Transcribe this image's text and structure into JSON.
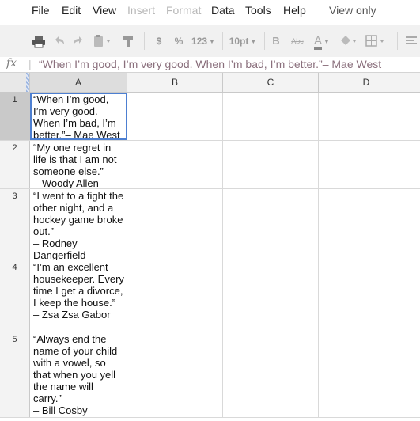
{
  "menu": [
    {
      "label": "File",
      "disabled": false
    },
    {
      "label": "Edit",
      "disabled": false
    },
    {
      "label": "View",
      "disabled": false
    },
    {
      "label": "Insert",
      "disabled": true
    },
    {
      "label": "Format",
      "disabled": true
    },
    {
      "label": "Data",
      "disabled": false
    },
    {
      "label": "Tools",
      "disabled": false
    },
    {
      "label": "Help",
      "disabled": false
    }
  ],
  "mode_label": "View only",
  "toolbar": {
    "currency": "$",
    "percent": "%",
    "number_format": "123",
    "font_size": "10pt",
    "bold": "B",
    "strikethrough": "Abc",
    "text_color": "A",
    "icons": [
      "print-icon",
      "undo-icon",
      "redo-icon",
      "paste-icon",
      "paint-format-icon",
      "fill-color-icon",
      "borders-icon",
      "align-icon"
    ]
  },
  "formula_bar": {
    "fx": "fx",
    "value": "“When I’m good, I’m very good. When I’m bad, I’m better.”– Mae West"
  },
  "columns": [
    "A",
    "B",
    "C",
    "D"
  ],
  "selected_cell": "A1",
  "rows": [
    {
      "num": "1",
      "a": "“When I’m good, I’m very good. When I’m bad, I’m better.”– Mae West"
    },
    {
      "num": "2",
      "a": "“My one regret in life is that I am not someone else.”\n– Woody Allen"
    },
    {
      "num": "3",
      "a": "“I went to a fight the other night, and a hockey game broke out.”\n– Rodney Dangerfield"
    },
    {
      "num": "4",
      "a": "“I’m an excellent housekeeper. Every time I get a divorce, I keep the house.”\n– Zsa Zsa Gabor"
    },
    {
      "num": "5",
      "a": "“Always end the name of your child with a vowel, so that when you yell the name will carry.”\n– Bill Cosby"
    }
  ]
}
